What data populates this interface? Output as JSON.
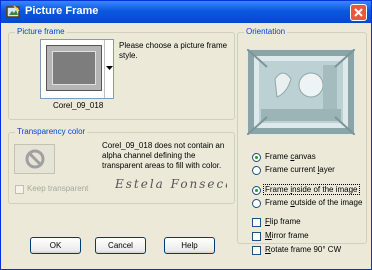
{
  "window": {
    "title": "Picture Frame"
  },
  "picture_frame": {
    "legend": "Picture frame",
    "prompt": "Please choose a picture frame style.",
    "selected_frame": "Corel_09_018"
  },
  "transparency": {
    "legend": "Transparency color",
    "message": "Corel_09_018 does not contain an alpha channel defining the transparent areas to fill with color.",
    "keep_transparent_label": "Keep transparent",
    "keep_transparent_checked": false,
    "keep_transparent_enabled": false,
    "signature_text": "Estela Fonseca"
  },
  "orientation": {
    "legend": "Orientation",
    "apply_to": [
      {
        "label_pre": "Frame ",
        "label_ul": "c",
        "label_post": "anvas",
        "selected": true
      },
      {
        "label_pre": "Frame current ",
        "label_ul": "l",
        "label_post": "ayer",
        "selected": false
      }
    ],
    "position": [
      {
        "label_pre": "Frame ",
        "label_ul": "i",
        "label_post": "nside of the image",
        "selected": true
      },
      {
        "label_pre": "Frame ",
        "label_ul": "o",
        "label_post": "utside of the image",
        "selected": false
      }
    ],
    "options": [
      {
        "label_pre": "",
        "label_ul": "F",
        "label_post": "lip frame",
        "checked": false
      },
      {
        "label_pre": "",
        "label_ul": "M",
        "label_post": "irror frame",
        "checked": false
      },
      {
        "label_pre": "",
        "label_ul": "R",
        "label_post": "otate frame 90° CW",
        "checked": false
      }
    ]
  },
  "buttons": {
    "ok": "OK",
    "cancel": "Cancel",
    "help": "Help"
  },
  "colors": {
    "title_bar": "#0a58e0",
    "close_button": "#e35b3a",
    "group_legend": "#0046d5",
    "radio_dot": "#21a121"
  }
}
